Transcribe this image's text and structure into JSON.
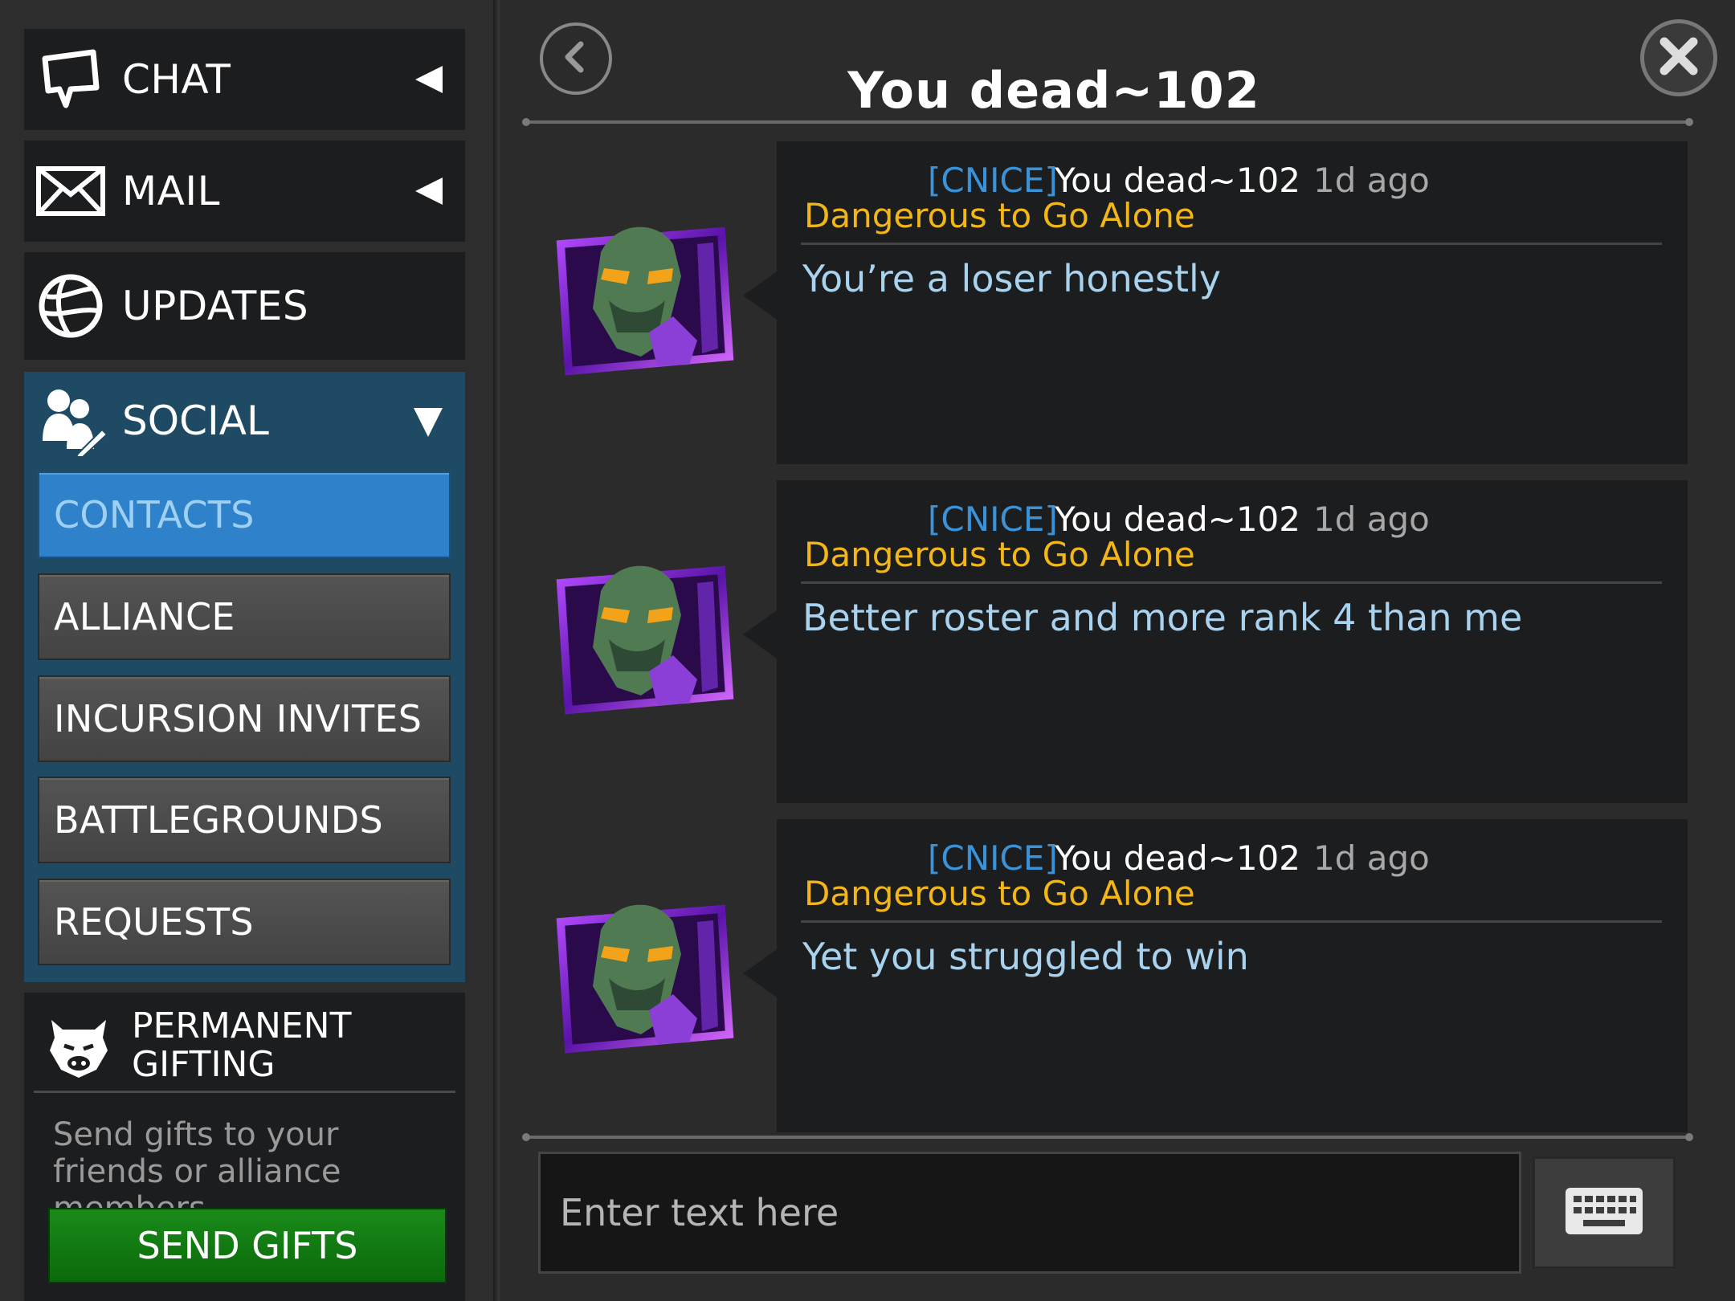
{
  "sidebar": {
    "chat": {
      "label": "CHAT",
      "icon": "speech-bubble-icon"
    },
    "mail": {
      "label": "MAIL",
      "icon": "envelope-icon"
    },
    "updates": {
      "label": "UPDATES",
      "icon": "globe-icon"
    },
    "social": {
      "label": "SOCIAL",
      "icon": "people-icon",
      "items": [
        {
          "label": "CONTACTS",
          "active": true
        },
        {
          "label": "ALLIANCE",
          "active": false
        },
        {
          "label": "INCURSION INVITES",
          "active": false
        },
        {
          "label": "BATTLEGROUNDS",
          "active": false
        },
        {
          "label": "REQUESTS",
          "active": false
        }
      ]
    },
    "gifting": {
      "title": "PERMANENT GIFTING",
      "description": "Send gifts to your friends or alliance members.",
      "button": "SEND GIFTS",
      "icon": "bull-icon"
    }
  },
  "conversation": {
    "title": "You dead~102",
    "messages": [
      {
        "tag": "[CNICE]",
        "name": "You dead~102",
        "time": "1d ago",
        "alliance": "Dangerous to Go Alone",
        "text": "You’re a loser honestly"
      },
      {
        "tag": "[CNICE]",
        "name": "You dead~102",
        "time": "1d ago",
        "alliance": "Dangerous to Go Alone",
        "text": "Better roster and more rank 4 than me"
      },
      {
        "tag": "[CNICE]",
        "name": "You dead~102",
        "time": "1d ago",
        "alliance": "Dangerous to Go Alone",
        "text": "Yet you struggled to win"
      }
    ],
    "input_placeholder": "Enter text here"
  },
  "colors": {
    "tag": "#3a93d8",
    "alliance": "#f2b619",
    "message_text": "#a8d2ee",
    "active_item": "#2f82c9",
    "send_button": "#1a8a1a",
    "social_panel": "#1e4a63"
  }
}
